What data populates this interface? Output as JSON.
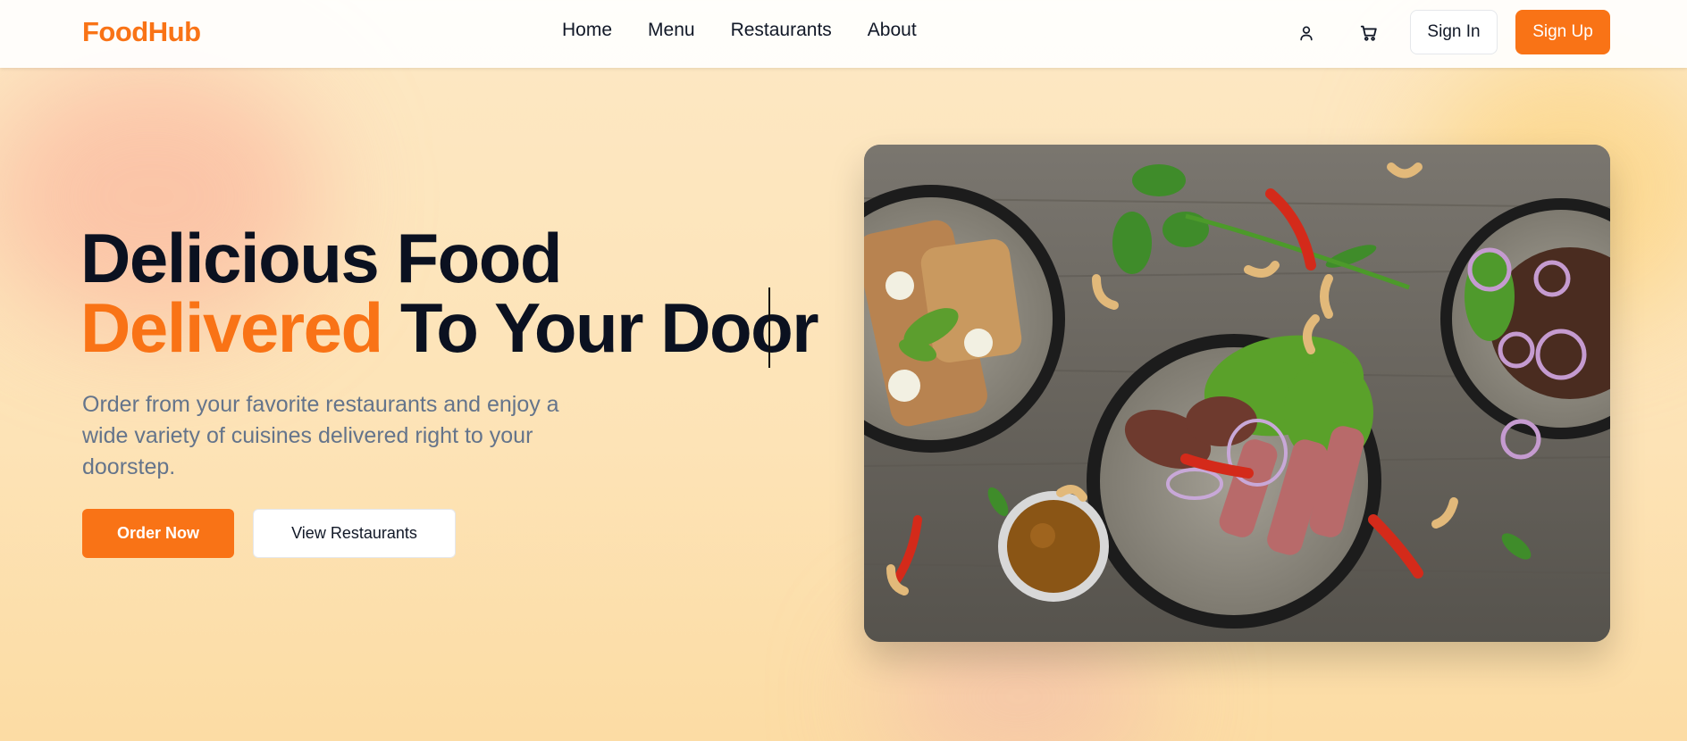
{
  "brand": {
    "name": "FoodHub",
    "accent_color": "#f97316"
  },
  "nav": {
    "items": [
      {
        "label": "Home"
      },
      {
        "label": "Menu"
      },
      {
        "label": "Restaurants"
      },
      {
        "label": "About"
      }
    ]
  },
  "header_actions": {
    "user_icon": "user-icon",
    "cart_icon": "cart-icon",
    "sign_in": "Sign In",
    "sign_up": "Sign Up"
  },
  "hero": {
    "title_line1": "Delicious Food",
    "title_accent": "Delivered",
    "title_rest": " To Your Door",
    "subtitle": "Order from your favorite restaurants and enjoy a wide variety of cuisines delivered right to your doorstep.",
    "primary_cta": "Order Now",
    "secondary_cta": "View Restaurants"
  }
}
